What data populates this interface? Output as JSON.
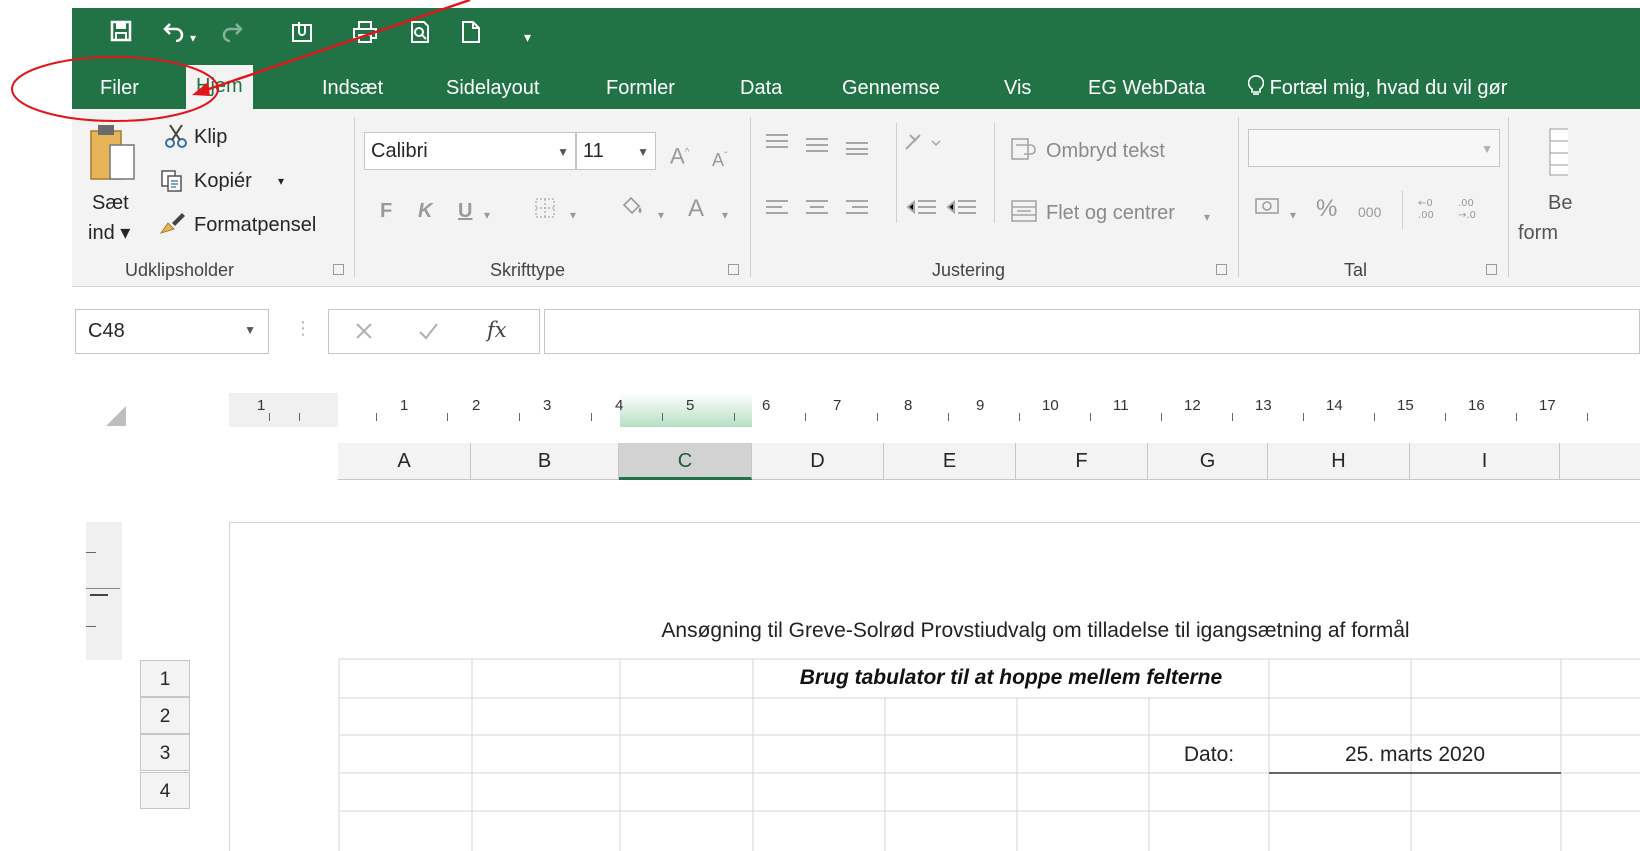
{
  "qat": {
    "undo_arrow": "▾",
    "customize": "▾"
  },
  "tabs": [
    "Filer",
    "Hjem",
    "Indsæt",
    "Sidelayout",
    "Formler",
    "Data",
    "Gennemse",
    "Vis",
    "EG WebData"
  ],
  "tell_me": "Fortæl mig, hvad du vil gør",
  "ribbon": {
    "clipboard": {
      "paste_top": "Sæt",
      "paste_bottom": "ind ▾",
      "cut": "Klip",
      "copy": "Kopiér",
      "copy_dd": "▾",
      "format_painter": "Formatpensel",
      "group": "Udklipsholder"
    },
    "font": {
      "name": "Calibri",
      "size": "11",
      "bold": "F",
      "italic": "K",
      "underline": "U",
      "group": "Skrifttype"
    },
    "alignment": {
      "wrap": "Ombryd tekst",
      "merge": "Flet og centrer",
      "group": "Justering"
    },
    "number": {
      "percent": "%",
      "thousands": "000",
      "group": "Tal"
    },
    "styles": {
      "partial_top": "Be",
      "partial_bottom": "form"
    }
  },
  "formula_bar": {
    "name_box": "C48",
    "fx": "fx",
    "value": ""
  },
  "ruler": [
    "1",
    "1",
    "2",
    "3",
    "4",
    "5",
    "6",
    "7",
    "8",
    "9",
    "10",
    "11",
    "12",
    "13",
    "14",
    "15",
    "16",
    "17"
  ],
  "columns": [
    "A",
    "B",
    "C",
    "D",
    "E",
    "F",
    "G",
    "H",
    "I"
  ],
  "rows": [
    "1",
    "2",
    "3",
    "4"
  ],
  "sheet": {
    "title": "Ansøgning til Greve-Solrød Provstiudvalg om tilladelse til igangsætning af formål",
    "instruction": "Brug tabulator til at hoppe mellem felterne",
    "date_label": "Dato:",
    "date_value": "25. marts 2020"
  },
  "colors": {
    "accent": "#217346",
    "annotation": "#e0161b"
  }
}
